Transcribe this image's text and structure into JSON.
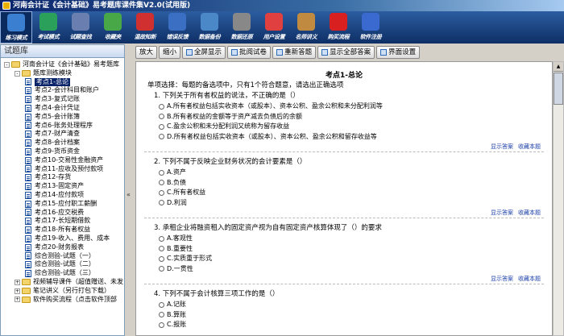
{
  "window": {
    "title": "河南会计证《会计基础》易考题库课件集V2.0(试用版)"
  },
  "toolbar": [
    {
      "label": "练习模式",
      "icon": "practice-icon",
      "color": "#3a7fd0"
    },
    {
      "label": "考试模式",
      "icon": "exam-icon",
      "color": "#2aa05a"
    },
    {
      "label": "试题查找",
      "icon": "search-icon",
      "color": "#6a7fb0"
    },
    {
      "label": "收藏夹",
      "icon": "bookmark-icon",
      "color": "#48a848"
    },
    {
      "label": "温故知新",
      "icon": "review-icon",
      "color": "#d03030"
    },
    {
      "label": "错误反馈",
      "icon": "feedback-icon",
      "color": "#3b6fc4"
    },
    {
      "label": "数据备份",
      "icon": "backup-icon",
      "color": "#4a88c8"
    },
    {
      "label": "数据还原",
      "icon": "restore-icon",
      "color": "#888888"
    },
    {
      "label": "用户设置",
      "icon": "settings-icon",
      "color": "#e04040"
    },
    {
      "label": "名师讲义",
      "icon": "lecture-icon",
      "color": "#c08a40"
    },
    {
      "label": "购买流程",
      "icon": "purchase-icon",
      "color": "#d82020"
    },
    {
      "label": "软件注册",
      "icon": "register-icon",
      "color": "#3a6ad0"
    }
  ],
  "left_panel": {
    "header": "试题库",
    "tree": [
      {
        "label": "河南会计证《会计基础》易考题库",
        "type": "folder",
        "level": 0,
        "expander": "-"
      },
      {
        "label": "题库测练模块",
        "type": "folder",
        "level": 1,
        "expander": "-"
      },
      {
        "label": "考点1-总论",
        "type": "doc",
        "level": 2,
        "selected": true
      },
      {
        "label": "考点2-会计科目和账户",
        "type": "doc",
        "level": 2
      },
      {
        "label": "考点3-复式记账",
        "type": "doc",
        "level": 2
      },
      {
        "label": "考点4-会计凭证",
        "type": "doc",
        "level": 2
      },
      {
        "label": "考点5-会计账簿",
        "type": "doc",
        "level": 2
      },
      {
        "label": "考点6-账务处理程序",
        "type": "doc",
        "level": 2
      },
      {
        "label": "考点7-财产清查",
        "type": "doc",
        "level": 2
      },
      {
        "label": "考点8-会计档案",
        "type": "doc",
        "level": 2
      },
      {
        "label": "考点9-货币资金",
        "type": "doc",
        "level": 2
      },
      {
        "label": "考点10-交易性金融资产",
        "type": "doc",
        "level": 2
      },
      {
        "label": "考点11-应收及预付款项",
        "type": "doc",
        "level": 2
      },
      {
        "label": "考点12-存货",
        "type": "doc",
        "level": 2
      },
      {
        "label": "考点13-固定资产",
        "type": "doc",
        "level": 2
      },
      {
        "label": "考点14-应付款项",
        "type": "doc",
        "level": 2
      },
      {
        "label": "考点15-应付职工薪酬",
        "type": "doc",
        "level": 2
      },
      {
        "label": "考点16-应交税费",
        "type": "doc",
        "level": 2
      },
      {
        "label": "考点17-长短期借款",
        "type": "doc",
        "level": 2
      },
      {
        "label": "考点18-所有者权益",
        "type": "doc",
        "level": 2
      },
      {
        "label": "考点19-收入、费用、成本",
        "type": "doc",
        "level": 2
      },
      {
        "label": "考点20-财务报表",
        "type": "doc",
        "level": 2
      },
      {
        "label": "综合测验-试题（一）",
        "type": "doc",
        "level": 2
      },
      {
        "label": "综合测验-试题（二）",
        "type": "doc",
        "level": 2
      },
      {
        "label": "综合测验-试题（三）",
        "type": "doc",
        "level": 2
      },
      {
        "label": "视频辅导课件（超值赠送、未发",
        "type": "folder",
        "level": 1,
        "expander": "+"
      },
      {
        "label": "笔记讲义（另行打包下载）",
        "type": "folder",
        "level": 1,
        "expander": "+"
      },
      {
        "label": "软件购买流程（点击软件顶部",
        "type": "folder",
        "level": 1,
        "expander": "+"
      }
    ]
  },
  "topbar": {
    "buttons": [
      {
        "label": "放大",
        "icon": false
      },
      {
        "label": "缩小",
        "icon": false
      },
      {
        "label": "全屏显示",
        "icon": true
      },
      {
        "label": "批阅试卷",
        "icon": true
      },
      {
        "label": "重新答题",
        "icon": true
      },
      {
        "label": "显示全部答案",
        "icon": true
      },
      {
        "label": "界面设置",
        "icon": true
      }
    ]
  },
  "content": {
    "section_title": "考点1-总论",
    "instructions": "单项选择：每题的备选项中，只有1个符合题意，请选出正确选项",
    "show_answer": "显示答案",
    "favorite": "收藏本题",
    "questions": [
      {
        "stem": "1. 下列关于所有者权益的说法，不正确的是（）",
        "options": [
          "A.所有者权益包括实收资本（或股本）、资本公积、盈余公积和未分配利润等",
          "B.所有者权益的金额等于资产减去负债后的余额",
          "C.盈余公积和未分配利润又统称为留存收益",
          "D.所有者权益包括实收资本（或股本）、资本公积、盈余公积和留存收益等"
        ]
      },
      {
        "stem": "2. 下列不属于反映企业财务状况的会计要素是（）",
        "options": [
          "A.资产",
          "B.负债",
          "C.所有者权益",
          "D.利润"
        ]
      },
      {
        "stem": "3. 承租企业将融资租入的固定资产视为自有固定资产核算体现了（）的要求",
        "options": [
          "A.客观性",
          "B.重要性",
          "C.实质重于形式",
          "D.一贯性"
        ]
      },
      {
        "stem": "4. 下列不属于会计核算三项工作的是（）",
        "options": [
          "A.记账",
          "B.算账",
          "C.报账"
        ]
      }
    ]
  }
}
